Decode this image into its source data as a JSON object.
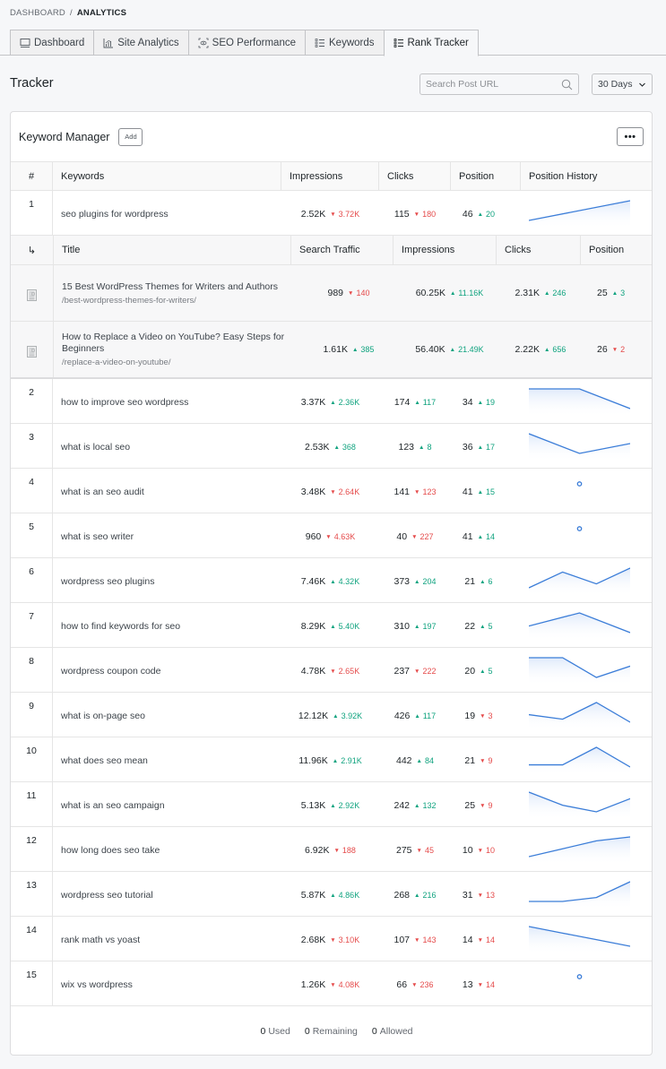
{
  "breadcrumb": {
    "parent": "DASHBOARD",
    "separator": "/",
    "current": "ANALYTICS"
  },
  "tabs": [
    {
      "label": "Dashboard",
      "icon": "monitor-icon",
      "active": false
    },
    {
      "label": "Site Analytics",
      "icon": "bar-chart-icon",
      "active": false
    },
    {
      "label": "SEO Performance",
      "icon": "eye-scan-icon",
      "active": false
    },
    {
      "label": "Keywords",
      "icon": "list-icon",
      "active": false
    },
    {
      "label": "Rank Tracker",
      "icon": "list-icon",
      "active": true
    }
  ],
  "tracker": {
    "title": "Tracker",
    "search_placeholder": "Search Post URL",
    "search_value": "",
    "period": "30 Days"
  },
  "keyword_manager": {
    "title": "Keyword Manager",
    "add_label": "Add",
    "more_label": "•••",
    "columns": [
      "#",
      "Keywords",
      "Impressions",
      "Clicks",
      "Position",
      "Position History"
    ],
    "sub_columns": [
      "↳",
      "Title",
      "Search Traffic",
      "Impressions",
      "Clicks",
      "Position"
    ],
    "rows": [
      {
        "num": "1",
        "keyword": "seo plugins for wordpress",
        "impressions": "2.52K",
        "imp_delta": "3.72K",
        "imp_dir": "down",
        "clicks": "115",
        "clk_delta": "180",
        "clk_dir": "down",
        "position": "46",
        "pos_delta": "20",
        "pos_dir": "up",
        "history": [
          3,
          1
        ],
        "expanded": true,
        "posts": [
          {
            "title": "15 Best WordPress Themes for Writers and Authors",
            "url": "/best-wordpress-themes-for-writers/",
            "traffic": "989",
            "traffic_delta": "140",
            "traffic_dir": "down",
            "impressions": "60.25K",
            "imp_delta": "11.16K",
            "imp_dir": "up",
            "clicks": "2.31K",
            "clk_delta": "246",
            "clk_dir": "up",
            "position": "25",
            "pos_delta": "3",
            "pos_dir": "up"
          },
          {
            "title": "How to Replace a Video on YouTube? Easy Steps for Beginners",
            "url": "/replace-a-video-on-youtube/",
            "traffic": "1.61K",
            "traffic_delta": "385",
            "traffic_dir": "up",
            "impressions": "56.40K",
            "imp_delta": "21.49K",
            "imp_dir": "up",
            "clicks": "2.22K",
            "clk_delta": "656",
            "clk_dir": "up",
            "position": "26",
            "pos_delta": "2",
            "pos_dir": "down"
          }
        ]
      },
      {
        "num": "2",
        "keyword": "how to improve seo wordpress",
        "impressions": "3.37K",
        "imp_delta": "2.36K",
        "imp_dir": "up",
        "clicks": "174",
        "clk_delta": "117",
        "clk_dir": "up",
        "position": "34",
        "pos_delta": "19",
        "pos_dir": "up",
        "history": [
          0,
          0,
          5
        ]
      },
      {
        "num": "3",
        "keyword": "what is local seo",
        "impressions": "2.53K",
        "imp_delta": "368",
        "imp_dir": "up",
        "clicks": "123",
        "clk_delta": "8",
        "clk_dir": "up",
        "position": "36",
        "pos_delta": "17",
        "pos_dir": "up",
        "history": [
          0,
          6,
          3
        ]
      },
      {
        "num": "4",
        "keyword": "what is an seo audit",
        "impressions": "3.48K",
        "imp_delta": "2.64K",
        "imp_dir": "down",
        "clicks": "141",
        "clk_delta": "123",
        "clk_dir": "down",
        "position": "41",
        "pos_delta": "15",
        "pos_dir": "up",
        "history": [
          41
        ]
      },
      {
        "num": "5",
        "keyword": "what is seo writer",
        "impressions": "960",
        "imp_delta": "4.63K",
        "imp_dir": "down",
        "clicks": "40",
        "clk_delta": "227",
        "clk_dir": "down",
        "position": "41",
        "pos_delta": "14",
        "pos_dir": "up",
        "history": [
          41
        ]
      },
      {
        "num": "6",
        "keyword": "wordpress seo plugins",
        "impressions": "7.46K",
        "imp_delta": "4.32K",
        "imp_dir": "up",
        "clicks": "373",
        "clk_delta": "204",
        "clk_dir": "up",
        "position": "21",
        "pos_delta": "6",
        "pos_dir": "up",
        "history": [
          5,
          1,
          4,
          0
        ]
      },
      {
        "num": "7",
        "keyword": "how to find keywords for seo",
        "impressions": "8.29K",
        "imp_delta": "5.40K",
        "imp_dir": "up",
        "clicks": "310",
        "clk_delta": "197",
        "clk_dir": "up",
        "position": "22",
        "pos_delta": "5",
        "pos_dir": "up",
        "history": [
          6,
          0,
          9
        ]
      },
      {
        "num": "8",
        "keyword": "wordpress coupon code",
        "impressions": "4.78K",
        "imp_delta": "2.65K",
        "imp_dir": "down",
        "clicks": "237",
        "clk_delta": "222",
        "clk_dir": "down",
        "position": "20",
        "pos_delta": "5",
        "pos_dir": "up",
        "history": [
          0,
          0,
          14,
          6
        ]
      },
      {
        "num": "9",
        "keyword": "what is on-page seo",
        "impressions": "12.12K",
        "imp_delta": "3.92K",
        "imp_dir": "up",
        "clicks": "426",
        "clk_delta": "117",
        "clk_dir": "up",
        "position": "19",
        "pos_delta": "3",
        "pos_dir": "down",
        "history": [
          8,
          11,
          0,
          13
        ]
      },
      {
        "num": "10",
        "keyword": "what does seo mean",
        "impressions": "11.96K",
        "imp_delta": "2.91K",
        "imp_dir": "up",
        "clicks": "442",
        "clk_delta": "84",
        "clk_dir": "up",
        "position": "21",
        "pos_delta": "9",
        "pos_dir": "down",
        "history": [
          8,
          8,
          0,
          9
        ]
      },
      {
        "num": "11",
        "keyword": "what is an seo campaign",
        "impressions": "5.13K",
        "imp_delta": "2.92K",
        "imp_dir": "up",
        "clicks": "242",
        "clk_delta": "132",
        "clk_dir": "up",
        "position": "25",
        "pos_delta": "9",
        "pos_dir": "down",
        "history": [
          0,
          10,
          15,
          5
        ]
      },
      {
        "num": "12",
        "keyword": "how long does seo take",
        "impressions": "6.92K",
        "imp_delta": "188",
        "imp_dir": "down",
        "clicks": "275",
        "clk_delta": "45",
        "clk_dir": "down",
        "position": "10",
        "pos_delta": "10",
        "pos_dir": "down",
        "history": [
          5,
          3,
          1,
          0
        ]
      },
      {
        "num": "13",
        "keyword": "wordpress seo tutorial",
        "impressions": "5.87K",
        "imp_delta": "4.86K",
        "imp_dir": "up",
        "clicks": "268",
        "clk_delta": "216",
        "clk_dir": "up",
        "position": "31",
        "pos_delta": "13",
        "pos_dir": "down",
        "history": [
          5,
          5,
          4,
          0
        ]
      },
      {
        "num": "14",
        "keyword": "rank math vs yoast",
        "impressions": "2.68K",
        "imp_delta": "3.10K",
        "imp_dir": "down",
        "clicks": "107",
        "clk_delta": "143",
        "clk_dir": "down",
        "position": "14",
        "pos_delta": "14",
        "pos_dir": "down",
        "history": [
          0,
          2,
          4,
          6
        ]
      },
      {
        "num": "15",
        "keyword": "wix vs wordpress",
        "impressions": "1.26K",
        "imp_delta": "4.08K",
        "imp_dir": "down",
        "clicks": "66",
        "clk_delta": "236",
        "clk_dir": "down",
        "position": "13",
        "pos_delta": "14",
        "pos_dir": "down",
        "history": [
          13
        ]
      }
    ],
    "footer": {
      "used": "0",
      "used_label": "Used",
      "remaining": "0",
      "remaining_label": "Remaining",
      "allowed": "0",
      "allowed_label": "Allowed"
    }
  },
  "colors": {
    "up": "#10a37f",
    "down": "#e54b4b",
    "spark": "#3b7dd8"
  }
}
